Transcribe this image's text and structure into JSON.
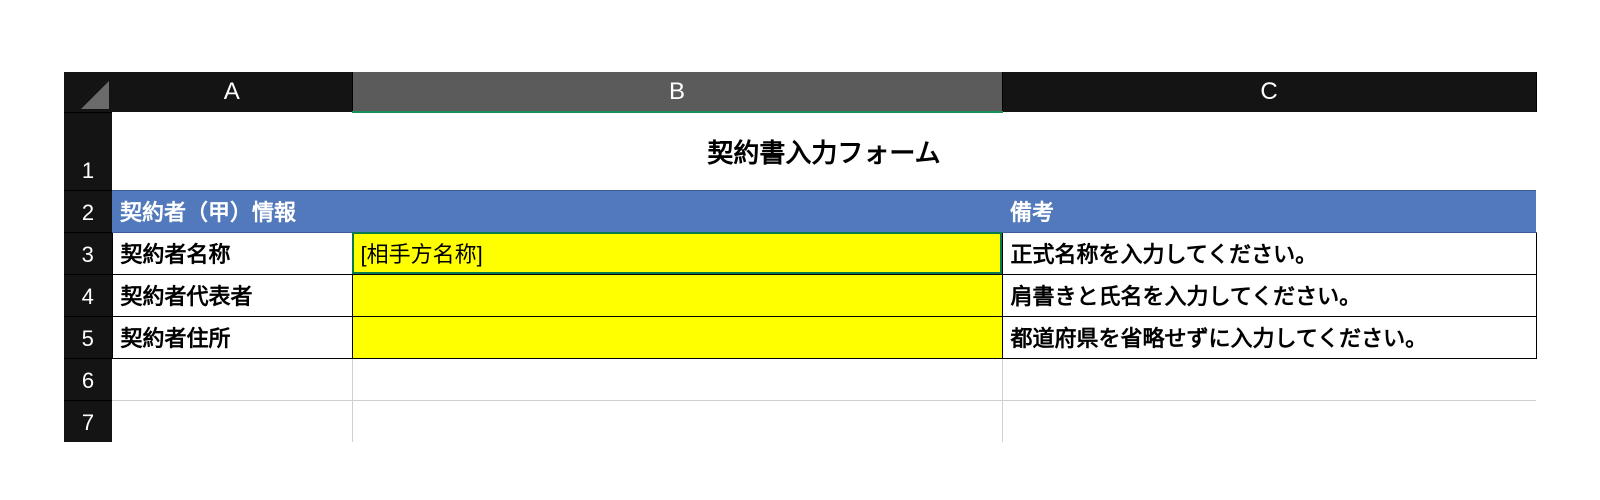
{
  "columns": {
    "A": "A",
    "B": "B",
    "C": "C"
  },
  "rowNumbers": [
    "1",
    "2",
    "3",
    "4",
    "5",
    "6",
    "7"
  ],
  "title": "契約書入力フォーム",
  "section": {
    "a": "契約者（甲）情報",
    "b": "",
    "c": "備考"
  },
  "rows": [
    {
      "label": "契約者名称",
      "value": "[相手方名称]",
      "note": "正式名称を入力してください。"
    },
    {
      "label": "契約者代表者",
      "value": "",
      "note": "肩書きと氏名を入力してください。"
    },
    {
      "label": "契約者住所",
      "value": "",
      "note": "都道府県を省略せずに入力してください。"
    }
  ]
}
